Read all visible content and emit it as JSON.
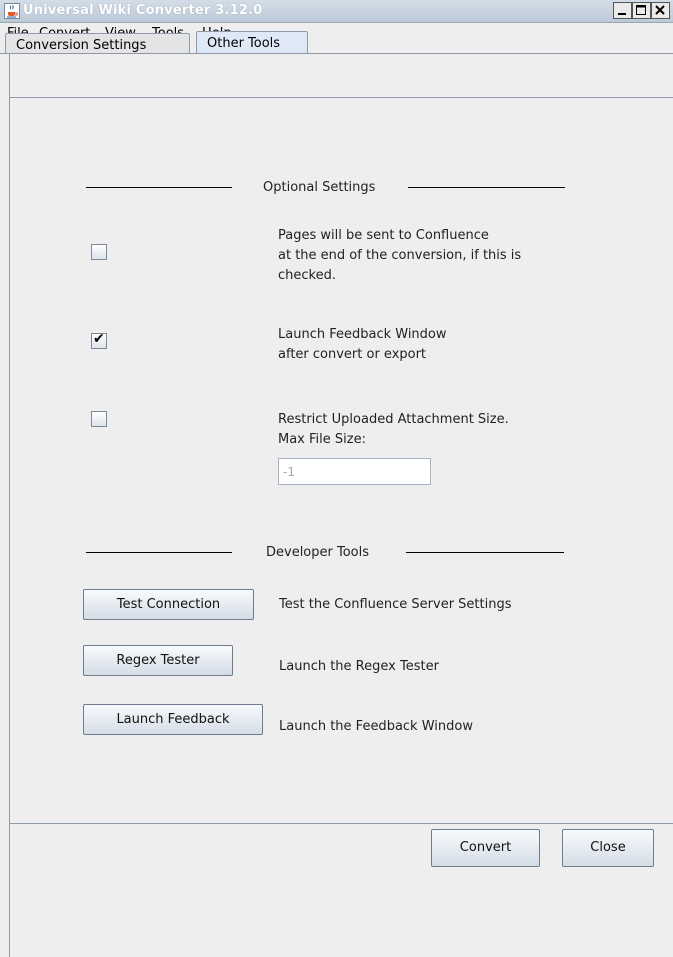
{
  "window": {
    "title": "Universal Wiki Converter 3.12.0"
  },
  "menu": [
    {
      "mnemonic": "F",
      "rest": "ile"
    },
    {
      "mnemonic": "C",
      "rest": "onvert"
    },
    {
      "mnemonic": "V",
      "rest": "iew"
    },
    {
      "mnemonic": "T",
      "rest": "ools"
    },
    {
      "mnemonic": "H",
      "rest": "elp"
    }
  ],
  "tabs": [
    {
      "label": "Conversion Settings",
      "active": false
    },
    {
      "label": "Other Tools",
      "active": true
    }
  ],
  "optional": {
    "section_title": "Optional Settings",
    "items": [
      {
        "checked": false,
        "line1": "Pages will be sent to Confluence",
        "line2": "at the end of the conversion, if this is",
        "line3": "checked."
      },
      {
        "checked": true,
        "line1": "Launch Feedback Window",
        "line2": "after convert or export"
      },
      {
        "checked": false,
        "line1": "Restrict Uploaded Attachment Size.",
        "line2": "Max File Size:"
      }
    ],
    "max_file_size_value": "-1"
  },
  "developer": {
    "section_title": "Developer Tools",
    "tools": [
      {
        "button": "Test Connection",
        "desc": "Test the Confluence Server Settings"
      },
      {
        "button": "Regex Tester",
        "desc": "Launch the Regex Tester"
      },
      {
        "button": "Launch Feedback",
        "desc": "Launch the Feedback Window"
      }
    ]
  },
  "footer": {
    "convert_label": "Convert",
    "close_label": "Close"
  },
  "icons": {
    "window_icon": "java-cup-icon",
    "checkmark": "✔"
  },
  "colors": {
    "panel_bg": "#eeeeee",
    "titlebar": "#bcc9d6",
    "active_tab": "#dfe8f6"
  }
}
